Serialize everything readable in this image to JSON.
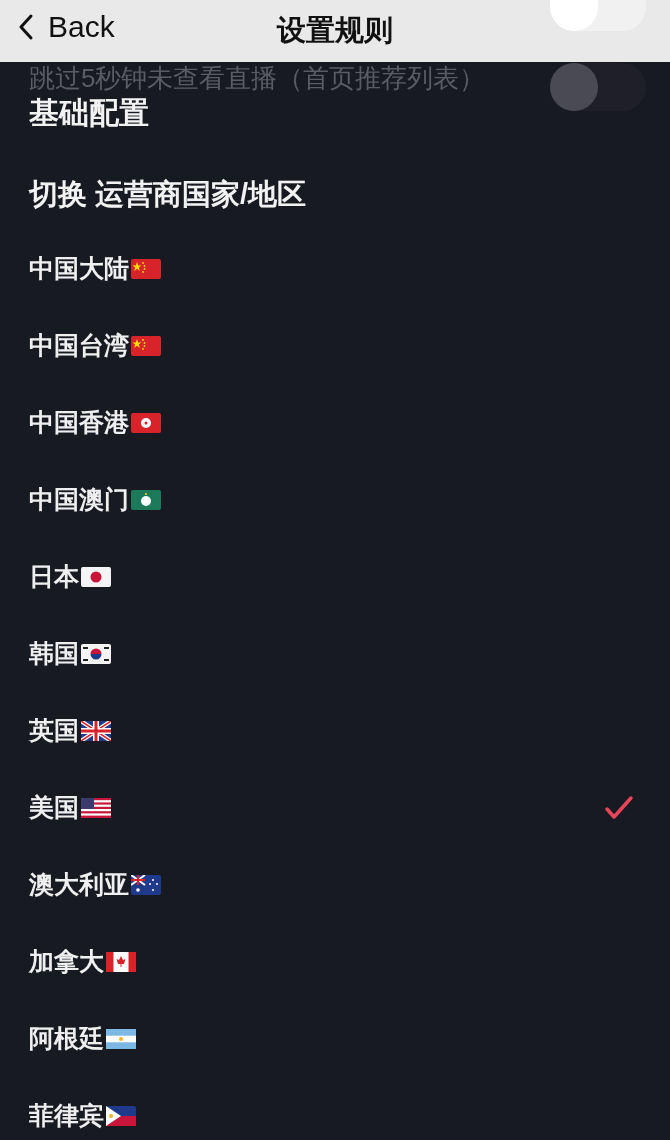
{
  "header": {
    "back": "Back",
    "title": "设置规则"
  },
  "behind_rows": [
    {
      "on": false
    },
    {
      "label": "跳过5秒钟未查看直播（首页推荐列表）",
      "on": false
    }
  ],
  "section_title": "基础配置",
  "region_heading": "切换 运营商国家/地区",
  "regions": [
    {
      "label": "中国大陆",
      "selected": false
    },
    {
      "label": "中国台湾",
      "selected": false
    },
    {
      "label": "中国香港",
      "selected": false
    },
    {
      "label": "中国澳门",
      "selected": false
    },
    {
      "label": "日本",
      "selected": false
    },
    {
      "label": "韩国",
      "selected": false
    },
    {
      "label": "英国",
      "selected": false
    },
    {
      "label": "美国",
      "selected": true
    },
    {
      "label": "澳大利亚",
      "selected": false
    },
    {
      "label": "加拿大",
      "selected": false
    },
    {
      "label": "阿根廷",
      "selected": false
    },
    {
      "label": "菲律宾",
      "selected": false
    }
  ]
}
